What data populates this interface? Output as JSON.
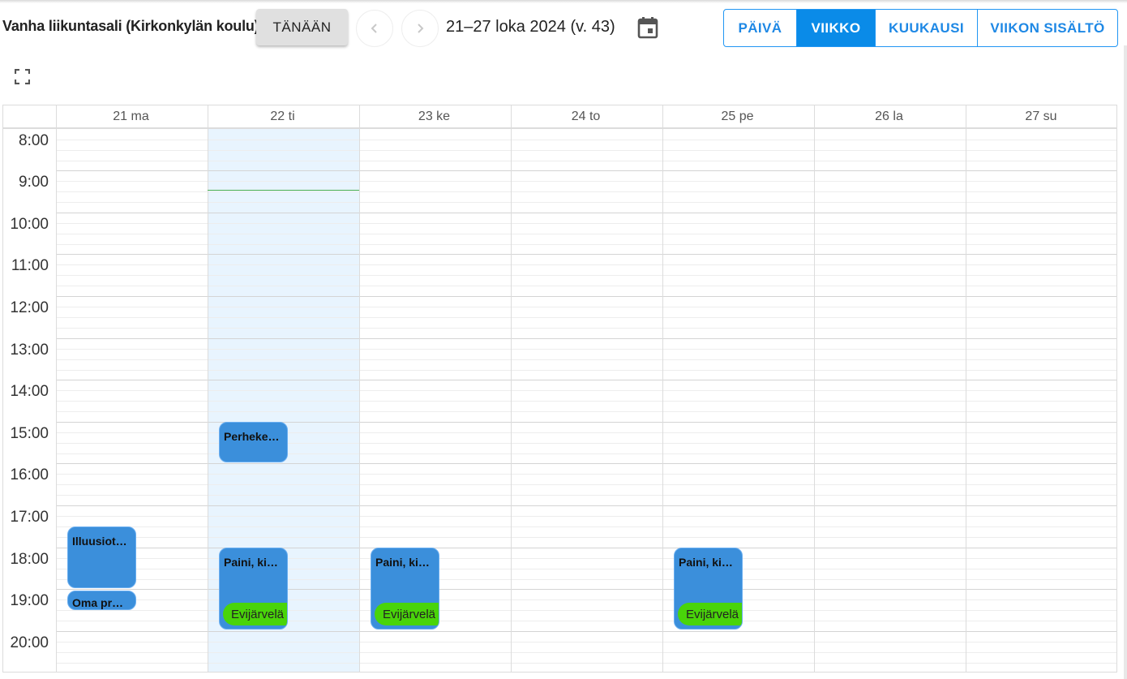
{
  "header": {
    "resource_title": "Vanha liikuntasali (Kirkonkylän koulu)",
    "today_label": "TÄNÄÄN",
    "date_range": "21–27 loka 2024 (v. 43)",
    "views": [
      {
        "label": "PÄIVÄ",
        "active": false
      },
      {
        "label": "VIIKKO",
        "active": true
      },
      {
        "label": "KUUKAUSI",
        "active": false
      },
      {
        "label": "VIIKON SISÄLTÖ",
        "active": false
      }
    ]
  },
  "icons": {
    "prev": "chevron-left-icon",
    "next": "chevron-right-icon",
    "calendar": "calendar-icon",
    "fullscreen": "fullscreen-icon"
  },
  "calendar": {
    "days": [
      "21 ma",
      "22 ti",
      "23 ke",
      "24 to",
      "25 pe",
      "26 la",
      "27 su"
    ],
    "today_index": 1,
    "hours": [
      "8:00",
      "9:00",
      "10:00",
      "11:00",
      "12:00",
      "13:00",
      "14:00",
      "15:00",
      "16:00",
      "17:00",
      "18:00",
      "19:00",
      "20:00"
    ],
    "events": [
      {
        "day": 0,
        "title": "Illuusiot…"
      },
      {
        "day": 0,
        "title": "Oma pr…"
      },
      {
        "day": 1,
        "title": "Perheke…"
      },
      {
        "day": 1,
        "title": "Paini, ki…",
        "tag": "Evijärvelä"
      },
      {
        "day": 2,
        "title": "Paini, ki…",
        "tag": "Evijärvelä"
      },
      {
        "day": 4,
        "title": "Paini, ki…",
        "tag": "Evijärvelä"
      }
    ]
  },
  "colors": {
    "accent": "#0a8be8",
    "event": "#3b8fdb",
    "tag": "#49d40a",
    "today_column": "#e8f4fe",
    "now_line": "#4caf50"
  }
}
